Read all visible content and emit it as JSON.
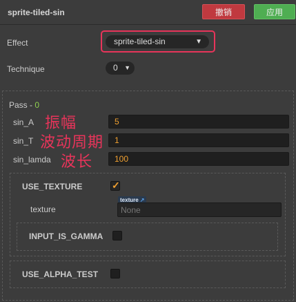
{
  "header": {
    "title": "sprite-tiled-sin",
    "revert_label": "撤销",
    "apply_label": "应用"
  },
  "effect": {
    "label": "Effect",
    "value": "sprite-tiled-sin"
  },
  "technique": {
    "label": "Technique",
    "value": "0"
  },
  "pass": {
    "label": "Pass - ",
    "index": "0",
    "properties": [
      {
        "name": "sin_A",
        "value": "5",
        "annotation": "振幅"
      },
      {
        "name": "sin_T",
        "value": "1",
        "annotation": "波动周期"
      },
      {
        "name": "sin_lamda",
        "value": "100",
        "annotation": "波长"
      }
    ],
    "use_texture": {
      "label": "USE_TEXTURE",
      "checked": true,
      "texture_label": "texture",
      "texture_tag": "texture",
      "texture_value": "None",
      "input_is_gamma": {
        "label": "INPUT_IS_GAMMA",
        "checked": false
      }
    },
    "use_alpha_test": {
      "label": "USE_ALPHA_TEST",
      "checked": false
    }
  },
  "colors": {
    "annotation": "#e8345a",
    "value": "#f0a030",
    "pass_index": "#8fd14f",
    "revert": "#c0393f",
    "apply": "#4fae52"
  }
}
